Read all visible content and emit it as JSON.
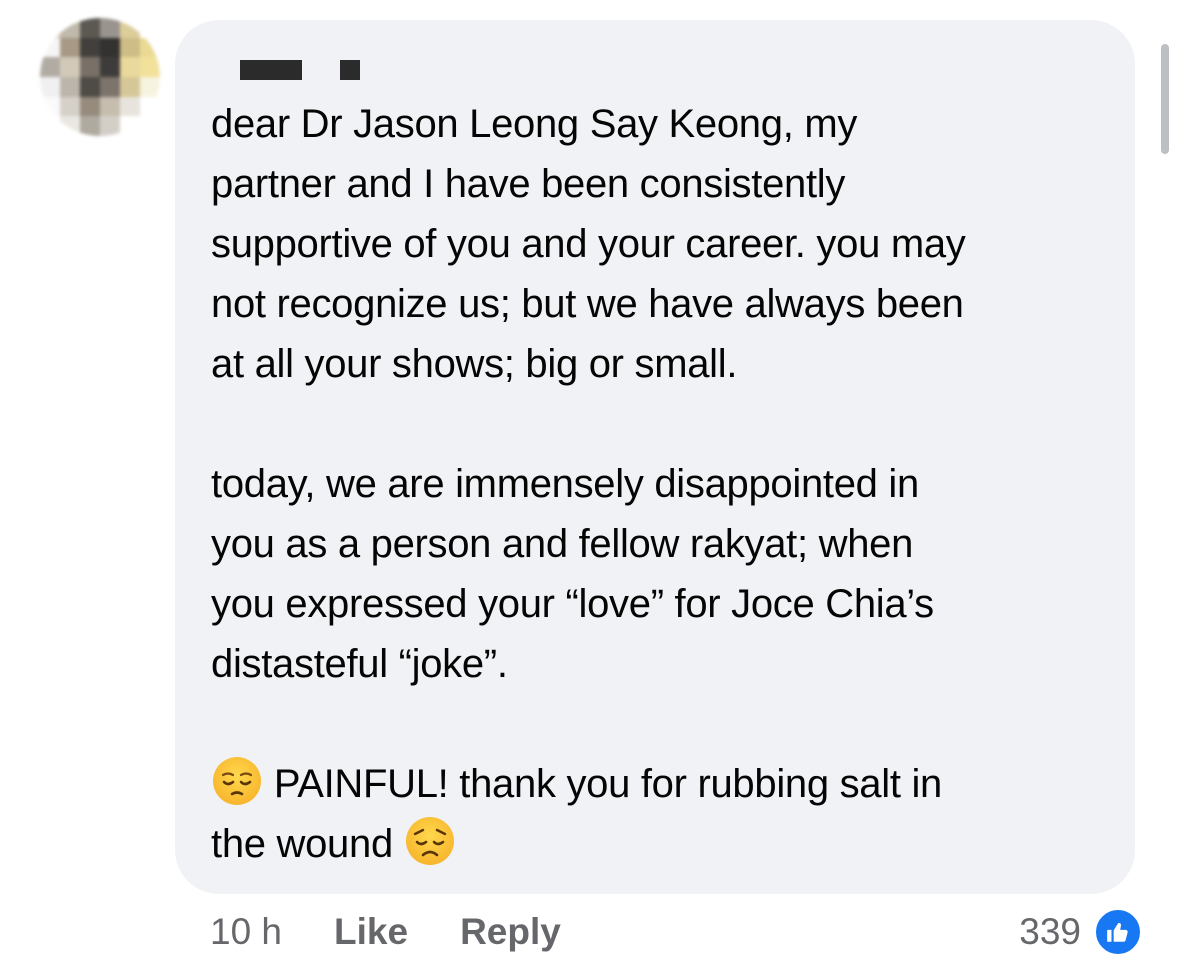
{
  "comment": {
    "paragraph_1": "dear Dr Jason Leong Say Keong, my\npartner and I have been consistently\nsupportive of you and your career. you may\nnot recognize us; but we have always been\nat all your shows; big or small.",
    "paragraph_2": "today, we are immensely disappointed in\nyou as a person and fellow rakyat; when\nyou expressed your “love” for Joce Chia’s\ndistasteful “joke”.",
    "paragraph_3_part_1": " PAINFUL! thank you for rubbing salt in\nthe wound ",
    "emoji_1": "pensive-face-emoji",
    "emoji_2": "disappointed-face-emoji"
  },
  "actions": {
    "time": "10 h",
    "like_label": "Like",
    "reply_label": "Reply"
  },
  "reactions": {
    "count": "339",
    "icon": "thumbs-up-icon"
  },
  "colors": {
    "bubble_bg": "#f0f2f5",
    "text": "#050505",
    "meta_text": "#65676b",
    "like_blue": "#1877f2"
  }
}
